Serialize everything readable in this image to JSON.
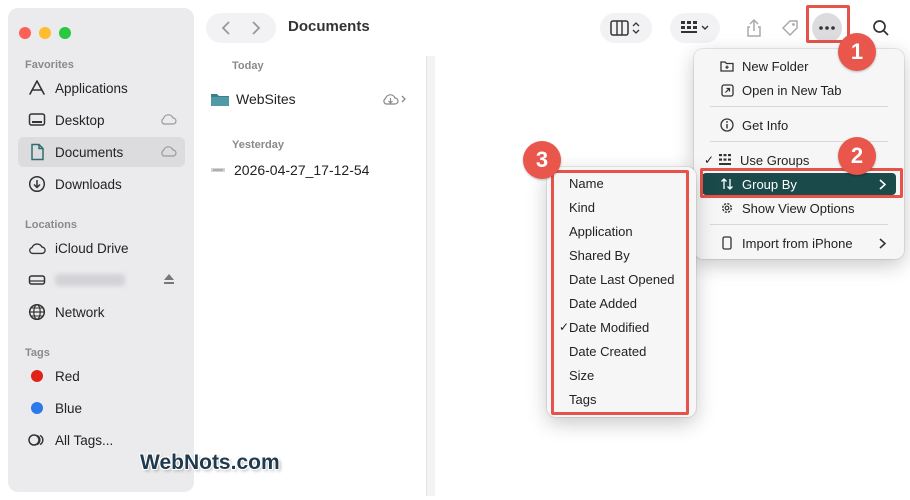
{
  "window": {
    "title": "Documents"
  },
  "sidebar": {
    "favorites_title": "Favorites",
    "favorites": [
      {
        "label": "Applications",
        "icon": "applications-icon"
      },
      {
        "label": "Desktop",
        "icon": "desktop-icon",
        "cloud": true
      },
      {
        "label": "Documents",
        "icon": "document-icon",
        "cloud": true,
        "active": true
      },
      {
        "label": "Downloads",
        "icon": "downloads-icon"
      }
    ],
    "locations_title": "Locations",
    "locations": [
      {
        "label": "iCloud Drive",
        "icon": "icloud-icon"
      },
      {
        "label": "",
        "icon": "drive-icon",
        "eject": true
      },
      {
        "label": "Network",
        "icon": "network-icon"
      }
    ],
    "tags_title": "Tags",
    "tags": [
      {
        "label": "Red",
        "color": "#e0221b"
      },
      {
        "label": "Blue",
        "color": "#2c79e8"
      },
      {
        "label": "All Tags...",
        "icon": "all-tags-icon"
      }
    ]
  },
  "file_list": {
    "groups": [
      {
        "header": "Today",
        "items": [
          {
            "name": "WebSites",
            "icon": "folder-icon",
            "cloud": true
          }
        ]
      },
      {
        "header": "Yesterday",
        "items": [
          {
            "name": "2026-04-27_17-12-54",
            "icon": "file-icon"
          }
        ]
      }
    ]
  },
  "more_menu": {
    "items": [
      {
        "label": "New Folder",
        "icon": "new-folder-icon"
      },
      {
        "label": "Open in New Tab",
        "icon": "new-tab-icon"
      },
      {
        "label": "Get Info",
        "icon": "info-icon"
      },
      {
        "label": "Use Groups",
        "icon": "grid-icon",
        "checked": true
      },
      {
        "label": "Group By",
        "icon": "sort-arrows-icon",
        "highlighted": true,
        "submenu": true
      },
      {
        "label": "Show View Options",
        "icon": "gear-icon"
      },
      {
        "label": "Import from iPhone",
        "icon": "iphone-icon",
        "submenu": true
      }
    ]
  },
  "group_by_menu": {
    "items": [
      "Name",
      "Kind",
      "Application",
      "Shared By",
      "Date Last Opened",
      "Date Added",
      "Date Modified",
      "Date Created",
      "Size",
      "Tags"
    ],
    "checked": "Date Modified"
  },
  "badges": [
    "1",
    "2",
    "3"
  ],
  "watermark": "WebNots.com",
  "colors": {
    "highlight": "#1a4a4a",
    "annotation": "#e5534b",
    "sidebar_bg": "#ebebed"
  }
}
